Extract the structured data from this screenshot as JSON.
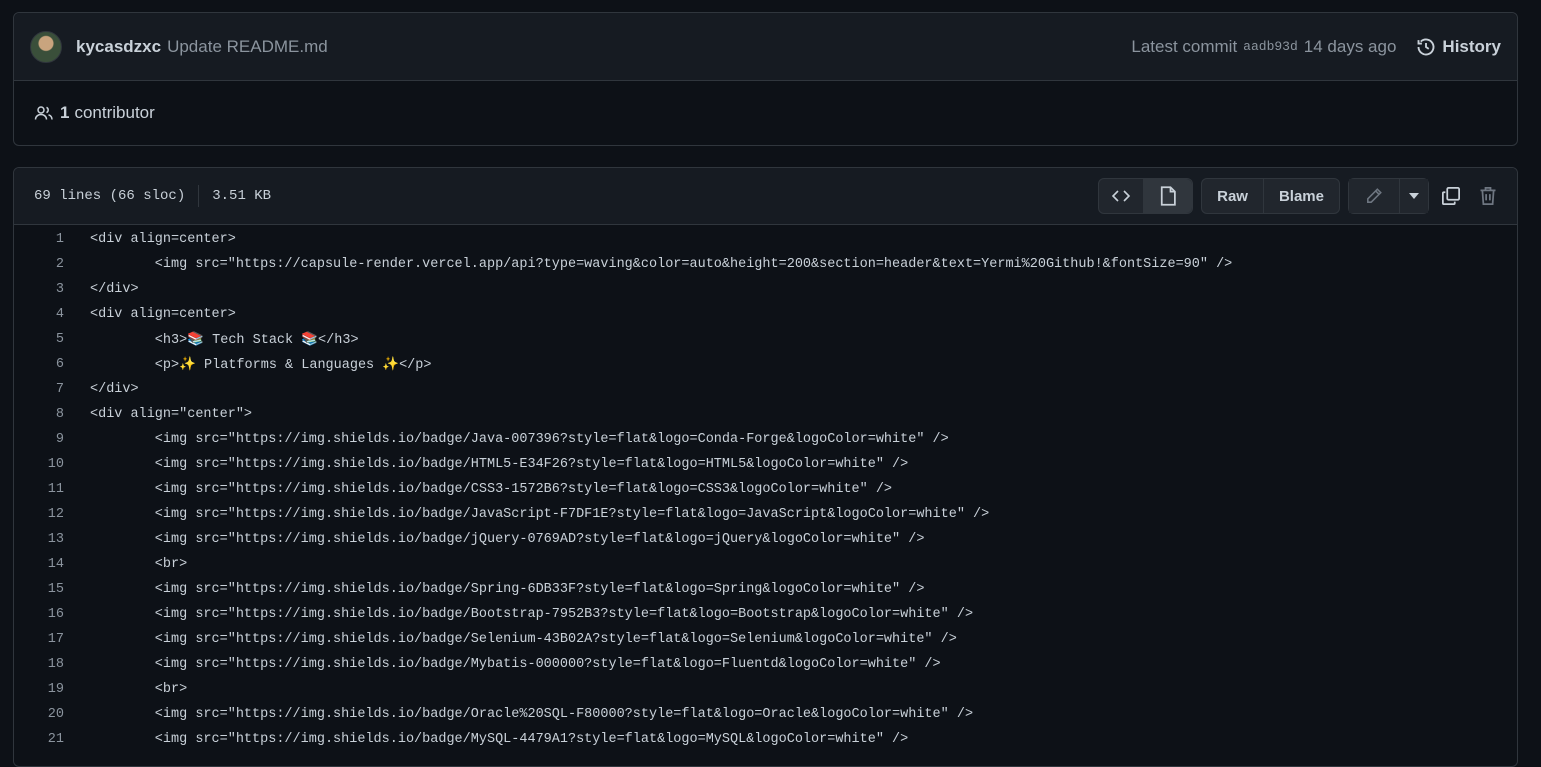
{
  "commit": {
    "author": "kycasdzxc",
    "message": "Update README.md",
    "latest_label": "Latest commit",
    "sha": "aadb93d",
    "ago": "14 days ago",
    "history_label": "History"
  },
  "contributors": {
    "count": "1",
    "label": "contributor"
  },
  "file": {
    "lines_info": "69 lines (66 sloc)",
    "size": "3.51 KB",
    "raw_label": "Raw",
    "blame_label": "Blame"
  },
  "icons": {
    "history": "history-icon",
    "people": "people-icon",
    "code": "code-icon",
    "file": "file-icon",
    "pencil": "pencil-icon",
    "caret": "triangle-down-icon",
    "copy": "copy-icon",
    "trash": "trash-icon"
  },
  "code_lines": [
    {
      "n": "1",
      "text": "<div align=center>"
    },
    {
      "n": "2",
      "text": "        <img src=\"https://capsule-render.vercel.app/api?type=waving&color=auto&height=200&section=header&text=Yermi%20Github!&fontSize=90\" />"
    },
    {
      "n": "3",
      "text": "</div>"
    },
    {
      "n": "4",
      "text": "<div align=center>"
    },
    {
      "n": "5",
      "text": "        <h3>📚 Tech Stack 📚</h3>"
    },
    {
      "n": "6",
      "text": "        <p>✨ Platforms & Languages ✨</p>"
    },
    {
      "n": "7",
      "text": "</div>"
    },
    {
      "n": "8",
      "text": "<div align=\"center\">"
    },
    {
      "n": "9",
      "text": "        <img src=\"https://img.shields.io/badge/Java-007396?style=flat&logo=Conda-Forge&logoColor=white\" />"
    },
    {
      "n": "10",
      "text": "        <img src=\"https://img.shields.io/badge/HTML5-E34F26?style=flat&logo=HTML5&logoColor=white\" />"
    },
    {
      "n": "11",
      "text": "        <img src=\"https://img.shields.io/badge/CSS3-1572B6?style=flat&logo=CSS3&logoColor=white\" />"
    },
    {
      "n": "12",
      "text": "        <img src=\"https://img.shields.io/badge/JavaScript-F7DF1E?style=flat&logo=JavaScript&logoColor=white\" />"
    },
    {
      "n": "13",
      "text": "        <img src=\"https://img.shields.io/badge/jQuery-0769AD?style=flat&logo=jQuery&logoColor=white\" />"
    },
    {
      "n": "14",
      "text": "        <br>"
    },
    {
      "n": "15",
      "text": "        <img src=\"https://img.shields.io/badge/Spring-6DB33F?style=flat&logo=Spring&logoColor=white\" />"
    },
    {
      "n": "16",
      "text": "        <img src=\"https://img.shields.io/badge/Bootstrap-7952B3?style=flat&logo=Bootstrap&logoColor=white\" />"
    },
    {
      "n": "17",
      "text": "        <img src=\"https://img.shields.io/badge/Selenium-43B02A?style=flat&logo=Selenium&logoColor=white\" />"
    },
    {
      "n": "18",
      "text": "        <img src=\"https://img.shields.io/badge/Mybatis-000000?style=flat&logo=Fluentd&logoColor=white\" />"
    },
    {
      "n": "19",
      "text": "        <br>"
    },
    {
      "n": "20",
      "text": "        <img src=\"https://img.shields.io/badge/Oracle%20SQL-F80000?style=flat&logo=Oracle&logoColor=white\" />"
    },
    {
      "n": "21",
      "text": "        <img src=\"https://img.shields.io/badge/MySQL-4479A1?style=flat&logo=MySQL&logoColor=white\" />"
    }
  ]
}
